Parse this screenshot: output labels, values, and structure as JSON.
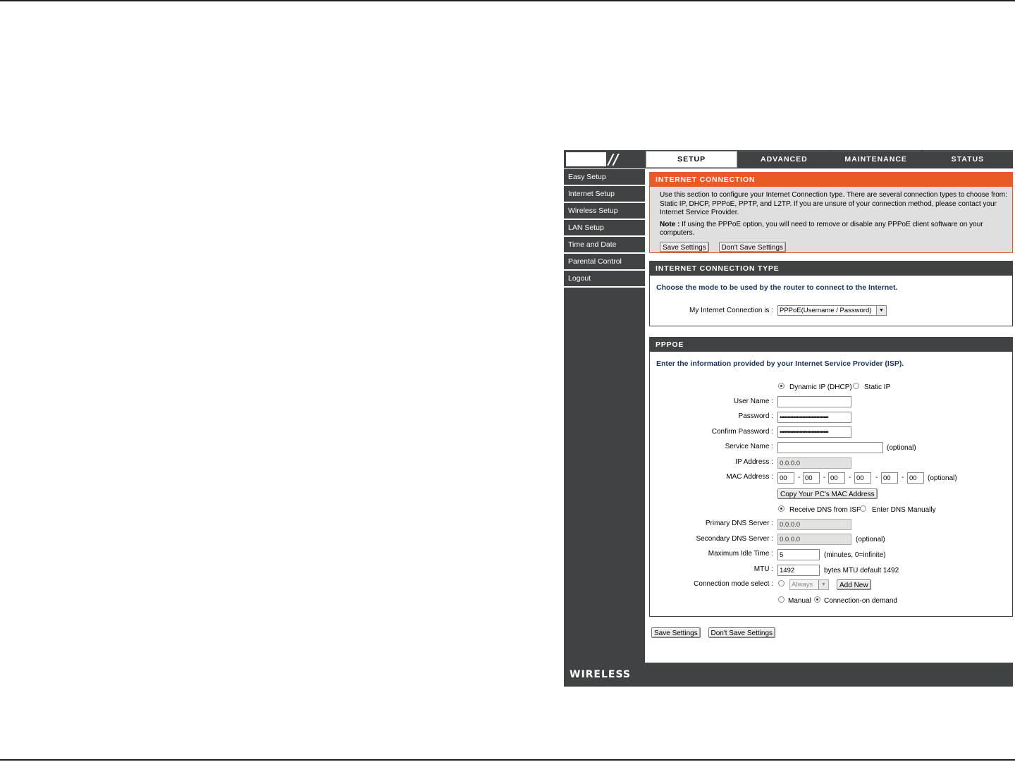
{
  "tabs": [
    {
      "label": "SETUP"
    },
    {
      "label": "ADVANCED"
    },
    {
      "label": "MAINTENANCE"
    },
    {
      "label": "STATUS"
    }
  ],
  "sidebar": {
    "items": [
      {
        "label": "Easy Setup"
      },
      {
        "label": "Internet Setup"
      },
      {
        "label": "Wireless Setup"
      },
      {
        "label": "LAN Setup"
      },
      {
        "label": "Time and Date"
      },
      {
        "label": "Parental Control"
      },
      {
        "label": "Logout"
      }
    ]
  },
  "internet_connection": {
    "title": "INTERNET CONNECTION",
    "description": "Use this section to configure your Internet Connection type. There are several connection types to choose from: Static IP, DHCP, PPPoE, PPTP, and L2TP. If you are unsure of your connection method, please contact your Internet Service Provider.",
    "note_label": "Note :",
    "note_text": " If using the PPPoE option, you will need to remove or disable any PPPoE client software on your computers.",
    "save_label": "Save Settings",
    "dont_save_label": "Don't Save Settings"
  },
  "connection_type": {
    "title": "INTERNET CONNECTION TYPE",
    "prompt": "Choose the mode to be used by the router to connect to the Internet.",
    "field_label": "My Internet Connection is :",
    "selected": "PPPoE(Username / Password)"
  },
  "pppoe": {
    "title": "PPPOE",
    "prompt": "Enter the information provided by your Internet Service Provider (ISP).",
    "ip_mode": {
      "dynamic": "Dynamic IP (DHCP)",
      "static": "Static IP",
      "selected": "dynamic"
    },
    "user_name_label": "User Name :",
    "user_name_value": "",
    "password_label": "Password :",
    "password_value": "••••••••••••••••••••••••••••••••",
    "confirm_password_label": "Confirm Password :",
    "confirm_password_value": "••••••••••••••••••••••••••••••••",
    "service_name_label": "Service Name :",
    "service_name_value": "",
    "optional": "(optional)",
    "ip_address_label": "IP Address :",
    "ip_address_value": "0.0.0.0",
    "mac_address_label": "MAC Address :",
    "mac_octets": [
      "00",
      "00",
      "00",
      "00",
      "00",
      "00"
    ],
    "copy_mac_label": "Copy Your PC's MAC Address",
    "dns_mode": {
      "isp": "Receive DNS from ISP",
      "manual": "Enter DNS Manually",
      "selected": "isp"
    },
    "primary_dns_label": "Primary DNS Server :",
    "primary_dns_value": "0.0.0.0",
    "secondary_dns_label": "Secondary DNS Server :",
    "secondary_dns_value": "0.0.0.0",
    "idle_time_label": "Maximum Idle Time :",
    "idle_time_value": "5",
    "idle_time_hint": "(minutes, 0=infinite)",
    "mtu_label": "MTU :",
    "mtu_value": "1492",
    "mtu_hint": "bytes MTU default 1492",
    "conn_mode_label": "Connection mode select :",
    "schedule_value": "Always",
    "add_new_label": "Add New",
    "manual_label": "Manual",
    "on_demand_label": "Connection-on demand"
  },
  "bottom": {
    "save_label": "Save Settings",
    "dont_save_label": "Don't Save Settings"
  },
  "footer": {
    "brand": "WIRELESS"
  }
}
